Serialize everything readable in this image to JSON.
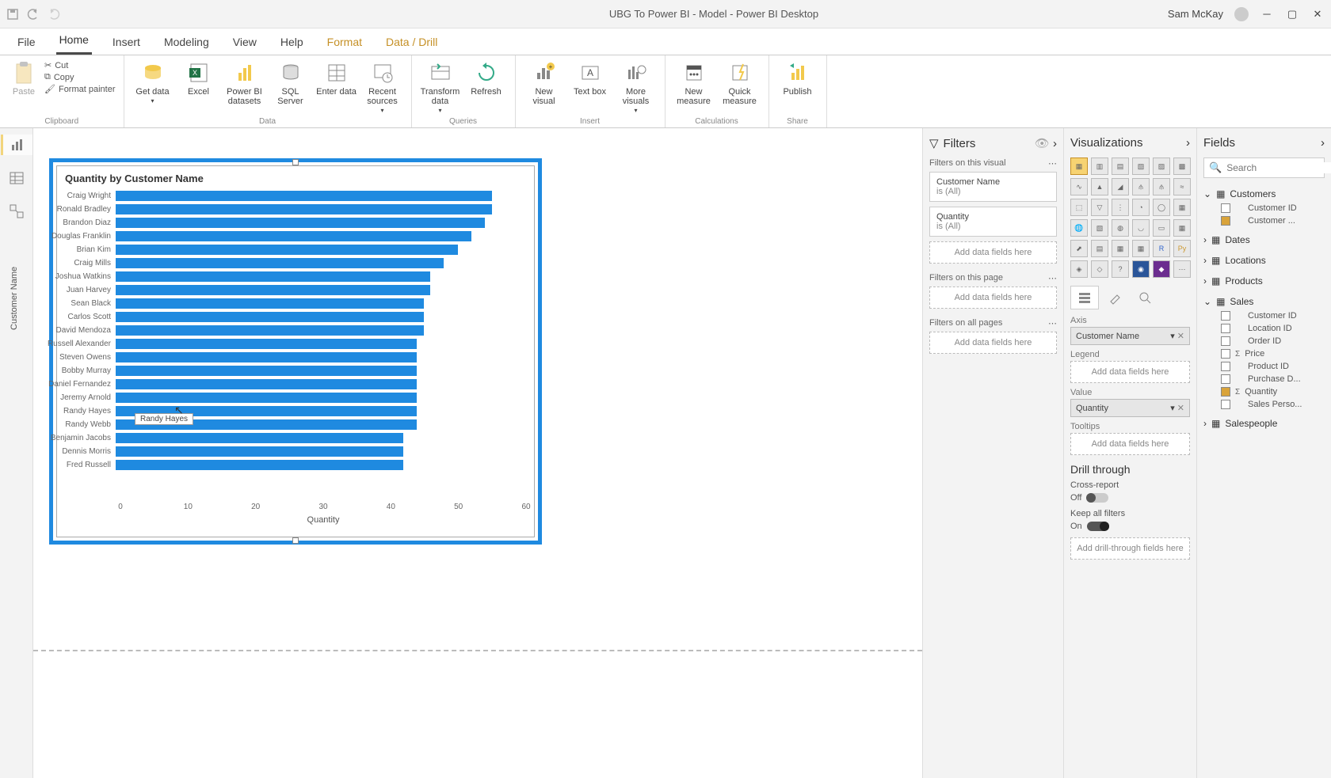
{
  "titlebar": {
    "title": "UBG To Power BI - Model - Power BI Desktop",
    "user": "Sam McKay"
  },
  "menu": [
    "File",
    "Home",
    "Insert",
    "Modeling",
    "View",
    "Help",
    "Format",
    "Data / Drill"
  ],
  "ribbon": {
    "clipboard": {
      "cut": "Cut",
      "copy": "Copy",
      "fmt": "Format painter",
      "paste": "Paste",
      "label": "Clipboard"
    },
    "data": {
      "get": "Get data",
      "excel": "Excel",
      "pbi": "Power BI datasets",
      "sql": "SQL Server",
      "enter": "Enter data",
      "recent": "Recent sources",
      "label": "Data"
    },
    "queries": {
      "transform": "Transform data",
      "refresh": "Refresh",
      "label": "Queries"
    },
    "insert": {
      "visual": "New visual",
      "text": "Text box",
      "more": "More visuals",
      "label": "Insert"
    },
    "calc": {
      "measure": "New measure",
      "quick": "Quick measure",
      "label": "Calculations"
    },
    "share": {
      "publish": "Publish",
      "label": "Share"
    }
  },
  "chart_data": {
    "type": "bar",
    "title": "Quantity by Customer Name",
    "xlabel": "Quantity",
    "ylabel": "Customer Name",
    "xlim": [
      0,
      60
    ],
    "x_ticks": [
      0,
      10,
      20,
      30,
      40,
      50,
      60
    ],
    "categories": [
      "Craig Wright",
      "Ronald Bradley",
      "Brandon Diaz",
      "Douglas Franklin",
      "Brian Kim",
      "Craig Mills",
      "Joshua Watkins",
      "Juan Harvey",
      "Sean Black",
      "Carlos Scott",
      "David Mendoza",
      "Russell Alexander",
      "Steven Owens",
      "Bobby Murray",
      "Daniel Fernandez",
      "Jeremy Arnold",
      "Randy Hayes",
      "Randy Webb",
      "Benjamin Jacobs",
      "Dennis Morris",
      "Fred Russell"
    ],
    "values": [
      55,
      55,
      54,
      52,
      50,
      48,
      46,
      46,
      45,
      45,
      45,
      44,
      44,
      44,
      44,
      44,
      44,
      44,
      42,
      42,
      42
    ],
    "tooltip": "Randy Hayes"
  },
  "filters": {
    "title": "Filters",
    "visual": {
      "label": "Filters on this visual",
      "cards": [
        {
          "name": "Customer Name",
          "state": "is (All)"
        },
        {
          "name": "Quantity",
          "state": "is (All)"
        }
      ],
      "add": "Add data fields here"
    },
    "page": {
      "label": "Filters on this page",
      "add": "Add data fields here"
    },
    "all": {
      "label": "Filters on all pages",
      "add": "Add data fields here"
    }
  },
  "viz": {
    "title": "Visualizations",
    "axis": {
      "label": "Axis",
      "value": "Customer Name"
    },
    "legend": {
      "label": "Legend",
      "add": "Add data fields here"
    },
    "value": {
      "label": "Value",
      "value": "Quantity"
    },
    "tooltips": {
      "label": "Tooltips",
      "add": "Add data fields here"
    },
    "drill": {
      "title": "Drill through",
      "cross": "Cross-report",
      "off": "Off",
      "keep": "Keep all filters",
      "on": "On",
      "add": "Add drill-through fields here"
    }
  },
  "fields": {
    "title": "Fields",
    "search": "Search",
    "tables": [
      {
        "name": "Customers",
        "open": true,
        "fields": [
          {
            "name": "Customer ID",
            "checked": false
          },
          {
            "name": "Customer ...",
            "checked": true
          }
        ]
      },
      {
        "name": "Dates",
        "open": false,
        "fields": []
      },
      {
        "name": "Locations",
        "open": false,
        "fields": []
      },
      {
        "name": "Products",
        "open": false,
        "fields": []
      },
      {
        "name": "Sales",
        "open": true,
        "fields": [
          {
            "name": "Customer ID",
            "checked": false
          },
          {
            "name": "Location ID",
            "checked": false
          },
          {
            "name": "Order ID",
            "checked": false
          },
          {
            "name": "Price",
            "checked": false,
            "sigma": true
          },
          {
            "name": "Product ID",
            "checked": false
          },
          {
            "name": "Purchase D...",
            "checked": false
          },
          {
            "name": "Quantity",
            "checked": true,
            "sigma": true
          },
          {
            "name": "Sales Perso...",
            "checked": false
          }
        ]
      },
      {
        "name": "Salespeople",
        "open": false,
        "fields": []
      }
    ]
  }
}
